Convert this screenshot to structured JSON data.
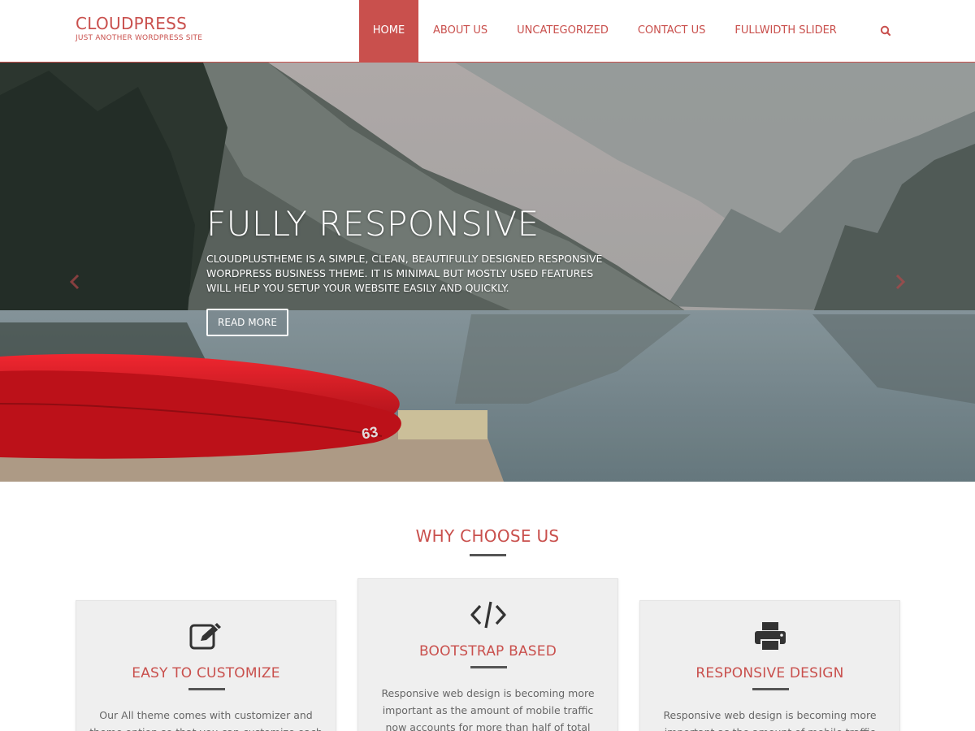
{
  "brand": {
    "title": "CLOUDPRESS",
    "tagline": "JUST ANOTHER WORDPRESS SITE"
  },
  "nav": {
    "items": [
      {
        "label": "HOME",
        "active": true
      },
      {
        "label": "ABOUT US",
        "active": false
      },
      {
        "label": "UNCATEGORIZED",
        "active": false
      },
      {
        "label": "CONTACT US",
        "active": false
      },
      {
        "label": "FULLWIDTH SLIDER",
        "active": false
      }
    ],
    "search_icon": "search-icon"
  },
  "hero": {
    "title": "FULLY RESPONSIVE",
    "text": "CLOUDPLUSTHEME IS A SIMPLE, CLEAN, BEAUTIFULLY DESIGNED RESPONSIVE WORDPRESS BUSINESS THEME. IT IS MINIMAL BUT MOSTLY USED FEATURES WILL HELP YOU SETUP YOUR WEBSITE EASILY AND QUICKLY.",
    "button_label": "READ MORE",
    "prev_icon": "chevron-left-icon",
    "next_icon": "chevron-right-icon"
  },
  "features": {
    "title": "WHY CHOOSE US",
    "cards": [
      {
        "icon": "edit-icon",
        "title": "EASY TO CUSTOMIZE",
        "text": "Our All theme comes with customizer and theme option so that you can customize each section"
      },
      {
        "icon": "code-icon",
        "title": "BOOTSTRAP BASED",
        "text": "Responsive web design is becoming more important as the amount of mobile traffic now accounts for more than half of total internet"
      },
      {
        "icon": "print-icon",
        "title": "RESPONSIVE DESIGN",
        "text": "Responsive web design is becoming more important as the amount of mobile traffic now"
      }
    ]
  },
  "colors": {
    "accent": "#c9504d",
    "card_bg": "#efefef",
    "text": "#666666"
  }
}
